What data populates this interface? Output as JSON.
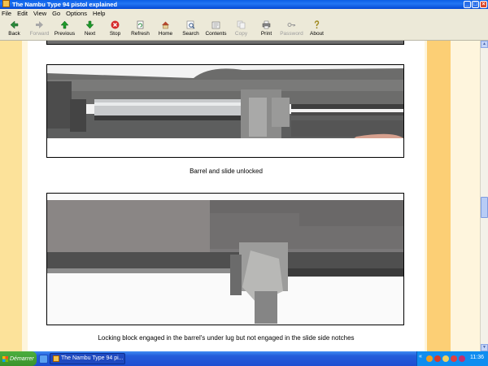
{
  "window": {
    "title": "The Nambu Type 94 pistol explained"
  },
  "menu": [
    "File",
    "Edit",
    "View",
    "Go",
    "Options",
    "Help"
  ],
  "toolbar": [
    {
      "name": "back",
      "label": "Back",
      "icon": "left-arrow-icon",
      "enabled": true,
      "color": "#2a8a3a"
    },
    {
      "name": "forward",
      "label": "Forward",
      "icon": "right-arrow-icon",
      "enabled": false,
      "color": "#9a9a9a"
    },
    {
      "name": "previous",
      "label": "Previous",
      "icon": "up-arrow-icon",
      "enabled": true,
      "color": "#1e9a2a"
    },
    {
      "name": "next",
      "label": "Next",
      "icon": "down-arrow-icon",
      "enabled": true,
      "color": "#1e9a2a"
    },
    {
      "name": "stop",
      "label": "Stop",
      "icon": "stop-icon",
      "enabled": true,
      "color": "#d62a2a"
    },
    {
      "name": "refresh",
      "label": "Refresh",
      "icon": "refresh-icon",
      "enabled": true,
      "color": "#3a6a3a"
    },
    {
      "name": "home",
      "label": "Home",
      "icon": "home-icon",
      "enabled": true,
      "color": "#8a5a2a"
    },
    {
      "name": "search",
      "label": "Search",
      "icon": "search-icon",
      "enabled": true,
      "color": "#3a5a8a"
    },
    {
      "name": "contents",
      "label": "Contents",
      "icon": "contents-icon",
      "enabled": true,
      "color": "#5a5a5a"
    },
    {
      "name": "copy",
      "label": "Copy",
      "icon": "copy-icon",
      "enabled": false,
      "color": "#a0a0a0"
    },
    {
      "name": "print",
      "label": "Print",
      "icon": "printer-icon",
      "enabled": true,
      "color": "#4a4a4a"
    },
    {
      "name": "password",
      "label": "Password",
      "icon": "key-icon",
      "enabled": false,
      "color": "#a0a0a0"
    },
    {
      "name": "about",
      "label": "About",
      "icon": "question-icon",
      "enabled": true,
      "color": "#a08a20"
    }
  ],
  "content": {
    "captions": [
      "Barrel and slide unlocked",
      "Locking block engaged in the barrel's under lug but not engaged in the slide side notches"
    ]
  },
  "taskbar": {
    "start_label": "Démarrer",
    "task_label": "The Nambu Type 94 pi...",
    "clock": "11:36"
  }
}
